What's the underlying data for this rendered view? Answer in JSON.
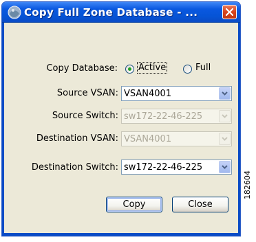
{
  "window": {
    "title": "Copy Full Zone Database - ..."
  },
  "copy_database": {
    "label": "Copy Database:",
    "options": [
      {
        "label": "Active",
        "selected": true
      },
      {
        "label": "Full",
        "selected": false
      }
    ]
  },
  "fields": {
    "source_vsan": {
      "label": "Source VSAN:",
      "value": "VSAN4001",
      "enabled": true
    },
    "source_switch": {
      "label": "Source Switch:",
      "value": "sw172-22-46-225",
      "enabled": false
    },
    "destination_vsan": {
      "label": "Destination VSAN:",
      "value": "VSAN4001",
      "enabled": false
    },
    "destination_switch": {
      "label": "Destination Switch:",
      "value": "sw172-22-46-225",
      "enabled": true
    }
  },
  "buttons": {
    "copy": "Copy",
    "close": "Close"
  },
  "figure_id": "182604",
  "colors": {
    "titlebar": "#0654d6",
    "client_bg": "#ece9d8",
    "radio_selected": "#21a121",
    "close_button": "#d8441c"
  }
}
